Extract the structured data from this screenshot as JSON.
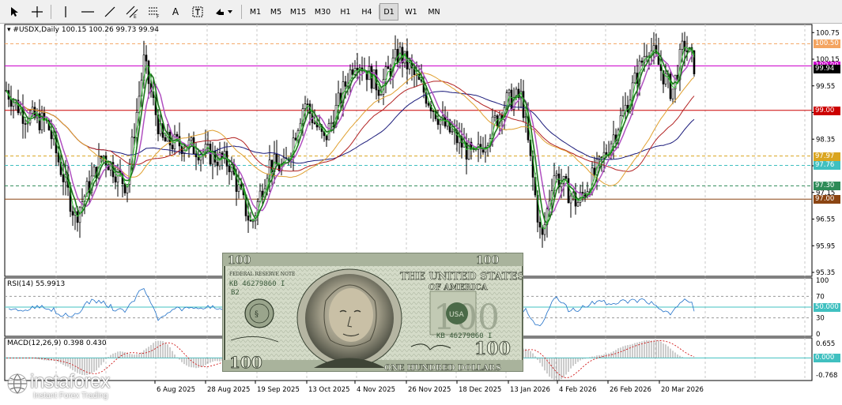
{
  "toolbar": {
    "tools": [
      {
        "name": "cursor-icon"
      },
      {
        "name": "crosshair-icon"
      },
      {
        "name": "vertical-line-icon"
      },
      {
        "name": "horizontal-line-icon"
      },
      {
        "name": "trendline-icon"
      },
      {
        "name": "channel-icon"
      },
      {
        "name": "fibonacci-icon"
      },
      {
        "name": "text-tool-label",
        "label": "A"
      },
      {
        "name": "text-label-icon"
      },
      {
        "name": "arrows-icon"
      }
    ],
    "timeframes": [
      "M1",
      "M5",
      "M15",
      "M30",
      "H1",
      "H4",
      "D1",
      "W1",
      "MN"
    ],
    "active_timeframe": "D1"
  },
  "chart_header": {
    "symbol_info": "#USDX,Daily  100.15 100.26 99.73 99.94"
  },
  "price_axis": {
    "ticks": [
      "100.75",
      "100.15",
      "99.55",
      "98.95",
      "98.35",
      "97.75",
      "97.15",
      "96.55",
      "95.95",
      "95.35"
    ],
    "labels": [
      {
        "text": "100.50",
        "color": "#f4a460"
      },
      {
        "text": "100.00",
        "color": "#cc00cc"
      },
      {
        "text": "99.94",
        "color": "#000000"
      },
      {
        "text": "99.00",
        "color": "#cc0000"
      },
      {
        "text": "97.97",
        "color": "#daa520"
      },
      {
        "text": "97.76",
        "color": "#40c0c0"
      },
      {
        "text": "97.30",
        "color": "#2e8b57"
      },
      {
        "text": "97.00",
        "color": "#8b4513"
      }
    ]
  },
  "rsi": {
    "label": "RSI(14) 55.9913",
    "ticks": [
      "100",
      "70",
      "50",
      "30",
      "0"
    ],
    "level_label": "50.000",
    "level_color": "#40c0c0"
  },
  "macd": {
    "label": "MACD(12,26,9) 0.398 0.430",
    "ticks": [
      "0.655",
      "0.000",
      "-0.768"
    ],
    "level_label": "0.000"
  },
  "time_axis": {
    "labels": [
      "6 Aug 2025",
      "28 Aug 2025",
      "19 Sep 2025",
      "13 Oct 2025",
      "4 Nov 2025",
      "26 Nov 2025",
      "18 Dec 2025",
      "13 Jan 2026",
      "4 Feb 2026",
      "26 Feb 2026",
      "20 Mar 2026"
    ]
  },
  "banknote": {
    "serial": "KB 46279860 I",
    "sub_code": "B2",
    "header": "FEDERAL RESERVE NOTE",
    "country": "THE UNITED STATES OF AMERICA",
    "denomination": "100",
    "words": "ONE HUNDRED DOLLARS"
  },
  "branding": {
    "name": "instaforex",
    "tagline": "Instant Forex Trading"
  }
}
